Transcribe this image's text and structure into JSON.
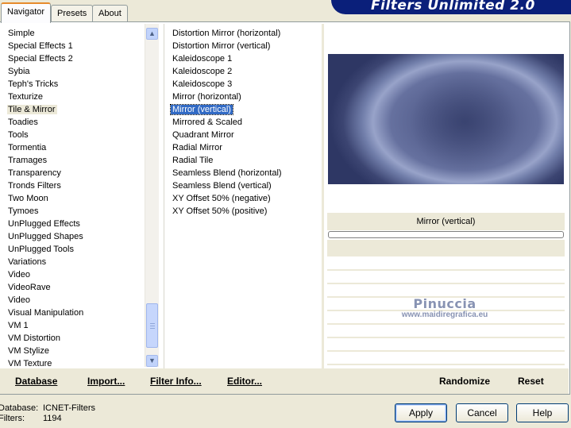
{
  "tabs": [
    {
      "label": "Navigator",
      "active": true
    },
    {
      "label": "Presets",
      "active": false
    },
    {
      "label": "About",
      "active": false
    }
  ],
  "banner_title": "Filters Unlimited 2.0",
  "categories": {
    "items": [
      "Simple",
      "Special Effects 1",
      "Special Effects 2",
      "Sybia",
      "Teph's Tricks",
      "Texturize",
      "Tile & Mirror",
      "Toadies",
      "Tools",
      "Tormentia",
      "Tramages",
      "Transparency",
      "Tronds Filters",
      "Two Moon",
      "Tymoes",
      "UnPlugged Effects",
      "UnPlugged Shapes",
      "UnPlugged Tools",
      "Variations",
      "Video",
      "VideoRave",
      "Video",
      "Visual Manipulation",
      "VM 1",
      "VM Distortion",
      "VM Stylize",
      "VM Texture"
    ],
    "selected": "Tile & Mirror"
  },
  "filters": {
    "items": [
      "Distortion Mirror (horizontal)",
      "Distortion Mirror (vertical)",
      "Kaleidoscope 1",
      "Kaleidoscope 2",
      "Kaleidoscope 3",
      "Mirror (horizontal)",
      "Mirror (vertical)",
      "Mirrored & Scaled",
      "Quadrant Mirror",
      "Radial Mirror",
      "Radial Tile",
      "Seamless Blend (horizontal)",
      "Seamless Blend (vertical)",
      "XY Offset 50% (negative)",
      "XY Offset 50% (positive)"
    ],
    "selected": "Mirror (vertical)"
  },
  "preview": {
    "effect_name": "Mirror (vertical)",
    "progress": 0
  },
  "watermark": {
    "name": "Pinuccia",
    "url": "www.maidiregrafica.eu"
  },
  "toolbar": {
    "database": "Database",
    "import": "Import...",
    "filter_info": "Filter Info...",
    "editor": "Editor...",
    "randomize": "Randomize",
    "reset": "Reset"
  },
  "status": {
    "database_label": "Database:",
    "database_value": "ICNET-Filters",
    "filters_label": "Filters:",
    "filters_value": "1194"
  },
  "buttons": {
    "apply": "Apply",
    "cancel": "Cancel",
    "help": "Help"
  },
  "colors": {
    "selection": "#316ac5",
    "banner": "#0a1f7a",
    "window_bg": "#ece9d8"
  }
}
